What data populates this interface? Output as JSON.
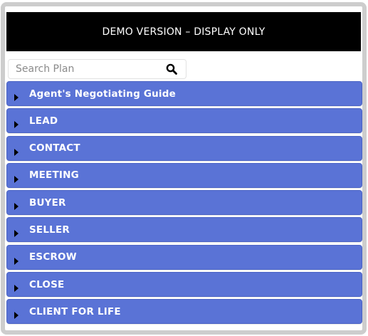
{
  "banner": {
    "text": "DEMO VERSION – DISPLAY ONLY"
  },
  "search": {
    "placeholder": "Search Plan",
    "value": "",
    "icon": "search-icon"
  },
  "accordion": {
    "items": [
      {
        "label": "Agent's Negotiating Guide",
        "icon": "caret-right-icon"
      },
      {
        "label": "LEAD",
        "icon": "caret-right-icon"
      },
      {
        "label": "CONTACT",
        "icon": "caret-right-icon"
      },
      {
        "label": "MEETING",
        "icon": "caret-right-icon"
      },
      {
        "label": "BUYER",
        "icon": "caret-right-icon"
      },
      {
        "label": "SELLER",
        "icon": "caret-right-icon"
      },
      {
        "label": "ESCROW",
        "icon": "caret-right-icon"
      },
      {
        "label": "CLOSE",
        "icon": "caret-right-icon"
      },
      {
        "label": "CLIENT FOR LIFE",
        "icon": "caret-right-icon"
      }
    ]
  },
  "colors": {
    "accordion_bg": "#5a73d6",
    "banner_bg": "#000000",
    "frame_border": "#cdcdcd"
  }
}
